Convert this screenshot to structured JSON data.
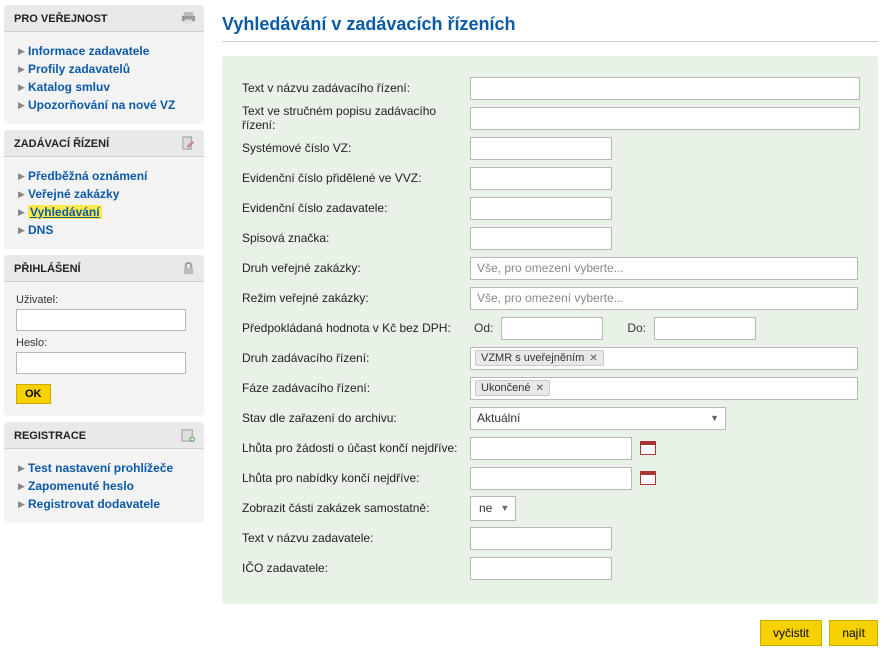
{
  "sidebar": {
    "s1": {
      "title": "PRO VEŘEJNOST",
      "items": [
        "Informace zadavatele",
        "Profily zadavatelů",
        "Katalog smluv",
        "Upozorňování na nové VZ"
      ]
    },
    "s2": {
      "title": "ZADÁVACÍ ŘÍZENÍ",
      "items": [
        "Předběžná oznámení",
        "Veřejné zakázky",
        "Vyhledávání",
        "DNS"
      ],
      "highlightIndex": 2
    },
    "s3": {
      "title": "PŘIHLÁŠENÍ",
      "user_label": "Uživatel:",
      "pass_label": "Heslo:",
      "ok": "OK"
    },
    "s4": {
      "title": "REGISTRACE",
      "items": [
        "Test nastavení prohlížeče",
        "Zapomenuté heslo",
        "Registrovat dodavatele"
      ]
    }
  },
  "page": {
    "title": "Vyhledávání v zadávacích řízeních"
  },
  "form": {
    "labels": {
      "nazev": "Text v názvu zadávacího řízení:",
      "popis": "Text ve stručném popisu zadávacího řízení:",
      "sysnum": "Systémové číslo VZ:",
      "vvz": "Evidenční číslo přidělené ve VVZ:",
      "evnum": "Evidenční číslo zadavatele:",
      "spis": "Spisová značka:",
      "druhvz": "Druh veřejné zakázky:",
      "rezim": "Režim veřejné zakázky:",
      "hodnota": "Předpokládaná hodnota v Kč bez DPH:",
      "od": "Od:",
      "do": "Do:",
      "druhzr": "Druh zadávacího řízení:",
      "faze": "Fáze zadávacího řízení:",
      "archiv": "Stav dle zařazení do archivu:",
      "lh_zad": "Lhůta pro žádosti o účast končí nejdříve:",
      "lh_nab": "Lhůta pro nabídky končí nejdříve:",
      "casti": "Zobrazit části zakázek samostatně:",
      "zadav": "Text v názvu zadavatele:",
      "ico": "IČO zadavatele:"
    },
    "placeholders": {
      "combo": "Vše, pro omezení vyberte..."
    },
    "values": {
      "druhzr_tag": "VZMR s uveřejněním",
      "faze_tag": "Ukončené",
      "archiv": "Aktuální",
      "casti": "ne"
    }
  },
  "actions": {
    "clear": "vyčistit",
    "find": "najít"
  }
}
